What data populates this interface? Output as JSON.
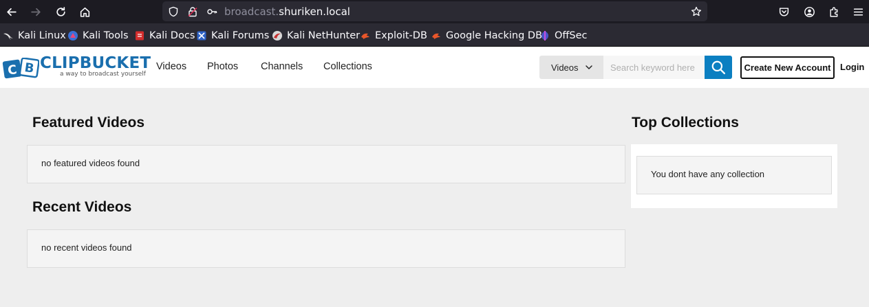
{
  "browser": {
    "url_prefix": "broadcast.",
    "url_host": "shuriken.local",
    "bookmarks": [
      {
        "label": "Kali Linux",
        "icon": "kali-dragon-icon"
      },
      {
        "label": "Kali Tools",
        "icon": "kali-tools-icon"
      },
      {
        "label": "Kali Docs",
        "icon": "kali-docs-icon"
      },
      {
        "label": "Kali Forums",
        "icon": "kali-forums-icon"
      },
      {
        "label": "Kali NetHunter",
        "icon": "nethunter-icon"
      },
      {
        "label": "Exploit-DB",
        "icon": "exploit-db-icon"
      },
      {
        "label": "Google Hacking DB",
        "icon": "ghdb-icon"
      },
      {
        "label": "OffSec",
        "icon": "offsec-icon"
      }
    ]
  },
  "site": {
    "logo_name": "CLIPBUCKET",
    "logo_tagline": "a way to broadcast yourself",
    "nav": [
      "Videos",
      "Photos",
      "Channels",
      "Collections"
    ],
    "search": {
      "type_selected": "Videos",
      "placeholder": "Search keyword here"
    },
    "create_account": "Create New Account",
    "login": "Login"
  },
  "main": {
    "featured_title": "Featured Videos",
    "featured_empty": "no featured videos found",
    "recent_title": "Recent Videos",
    "recent_empty": "no recent videos found"
  },
  "sidebar": {
    "title": "Top Collections",
    "empty": "You dont have any collection"
  },
  "colors": {
    "brand_blue": "#1a6fae",
    "search_button": "#0b7fc1",
    "browser_dark": "#1c1b22"
  }
}
